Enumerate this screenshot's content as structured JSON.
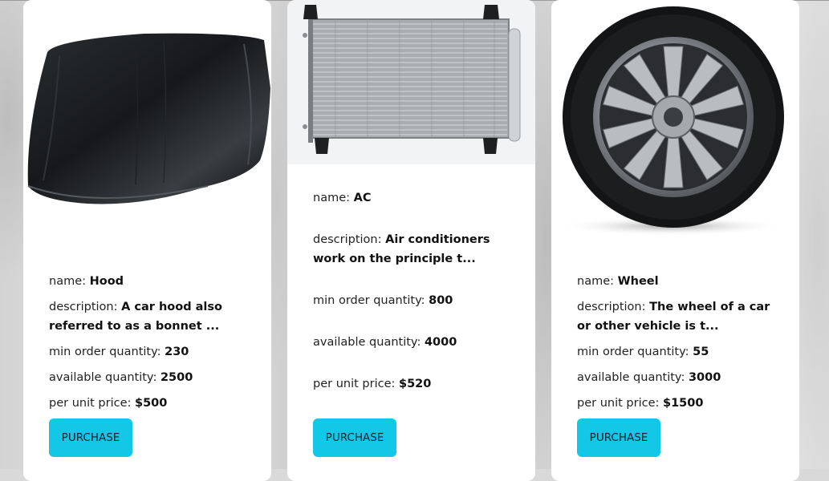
{
  "products": [
    {
      "name_label": "name: ",
      "name": "Hood",
      "description_label": "description: ",
      "description": "A car hood also referred to as a bonnet ...",
      "min_label": "min order quantity: ",
      "min_order_quantity": "230",
      "available_label": "available quantity: ",
      "available_quantity": "2500",
      "price_label": "per unit price: ",
      "price": "$500",
      "button": "PURCHASE"
    },
    {
      "name_label": "name: ",
      "name": "AC",
      "description_label": "description: ",
      "description": "Air conditioners work on the principle t...",
      "min_label": "min order quantity: ",
      "min_order_quantity": "800",
      "available_label": "available quantity: ",
      "available_quantity": "4000",
      "price_label": "per unit price: ",
      "price": "$520",
      "button": "PURCHASE"
    },
    {
      "name_label": "name: ",
      "name": "Wheel",
      "description_label": "description: ",
      "description": "The wheel of a car or other vehicle is t...",
      "min_label": "min order quantity: ",
      "min_order_quantity": "55",
      "available_label": "available quantity: ",
      "available_quantity": "3000",
      "price_label": "per unit price: ",
      "price": "$1500",
      "button": "PURCHASE"
    }
  ],
  "colors": {
    "button": "#13c7e6",
    "card": "#ffffff"
  }
}
